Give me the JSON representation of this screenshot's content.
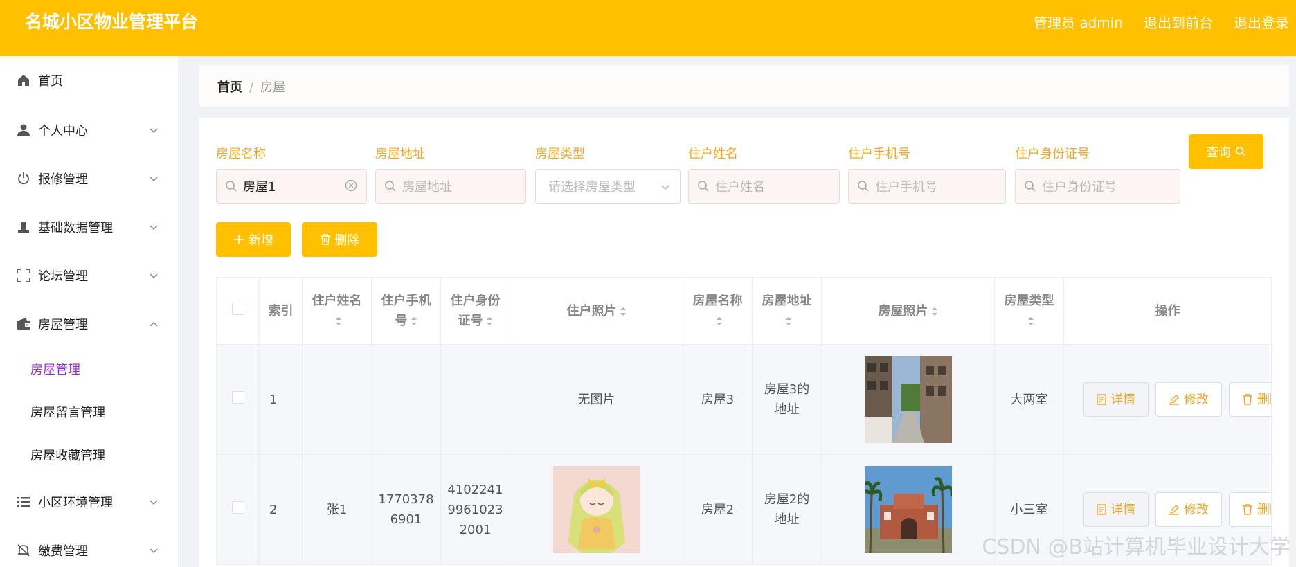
{
  "app": {
    "title": "名城小区物业管理平台"
  },
  "header": {
    "admin_label": "管理员 admin",
    "front_link": "退出到前台",
    "logout_link": "退出登录"
  },
  "sidebar": {
    "items": [
      {
        "label": "首页",
        "icon": "home-icon"
      },
      {
        "label": "个人中心",
        "icon": "user-icon"
      },
      {
        "label": "报修管理",
        "icon": "power-icon"
      },
      {
        "label": "基础数据管理",
        "icon": "stamp-icon"
      },
      {
        "label": "论坛管理",
        "icon": "frame-icon"
      },
      {
        "label": "房屋管理",
        "icon": "wallet-icon",
        "expanded": true
      },
      {
        "label": "小区环境管理",
        "icon": "list-icon"
      },
      {
        "label": "缴费管理",
        "icon": "bell-off-icon"
      }
    ],
    "sub_items": [
      {
        "label": "房屋管理",
        "active": true
      },
      {
        "label": "房屋留言管理"
      },
      {
        "label": "房屋收藏管理"
      }
    ]
  },
  "breadcrumb": {
    "home": "首页",
    "separator": "/",
    "current": "房屋"
  },
  "filters": {
    "house_name": {
      "label": "房屋名称",
      "value": "房屋1"
    },
    "house_addr": {
      "label": "房屋地址",
      "placeholder": "房屋地址"
    },
    "house_type": {
      "label": "房屋类型",
      "placeholder": "请选择房屋类型"
    },
    "resident_name": {
      "label": "住户姓名",
      "placeholder": "住户姓名"
    },
    "resident_phone": {
      "label": "住户手机号",
      "placeholder": "住户手机号"
    },
    "resident_id": {
      "label": "住户身份证号",
      "placeholder": "住户身份证号"
    },
    "search_label": "查询"
  },
  "actions": {
    "add_label": "新增",
    "delete_label": "删除"
  },
  "table": {
    "headers": {
      "index": "索引",
      "name_1": "住户姓名",
      "phone_1": "住户手机",
      "phone_2": "号",
      "id_1": "住户身份",
      "id_2": "证号",
      "photo": "住户照片",
      "house_name": "房屋名称",
      "house_addr": "房屋地址",
      "house_photo": "房屋照片",
      "house_type": "房屋类型",
      "ops": "操作"
    },
    "rows": [
      {
        "index": "1",
        "name": "",
        "phone_1": "",
        "phone_2": "",
        "id_1": "",
        "id_2": "",
        "id_3": "",
        "photo_text": "无图片",
        "house_name": "房屋3",
        "addr_1": "房屋3的",
        "addr_2": "地址",
        "house_type": "大两室"
      },
      {
        "index": "2",
        "name": "张1",
        "phone_1": "1770378",
        "phone_2": "6901",
        "id_1": "4102241",
        "id_2": "9961023",
        "id_3": "2001",
        "photo_text": "",
        "house_name": "房屋2",
        "addr_1": "房屋2的",
        "addr_2": "地址",
        "house_type": "小三室"
      }
    ],
    "op_labels": {
      "detail": "详情",
      "edit": "修改",
      "delete": "删除"
    }
  },
  "watermark": "CSDN @B站计算机毕业设计大学"
}
